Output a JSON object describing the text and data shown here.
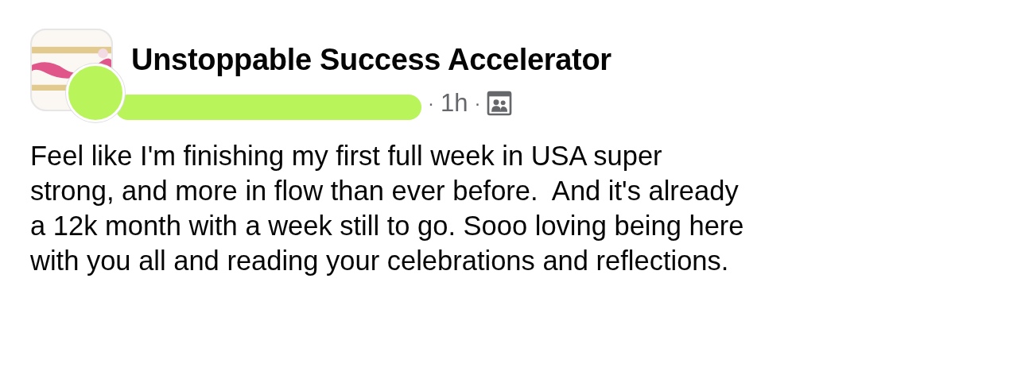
{
  "post": {
    "group_name": "Unstoppable Success Accelerator",
    "meta": {
      "separator_1": "·",
      "time": "1h",
      "separator_2": "·"
    },
    "body_lines": [
      "Feel like I'm finishing my first full week in USA super",
      "strong, and more in flow than ever before.  And it's already",
      "a 12k month with a week still to go. Sooo loving being here",
      "with you all and reading your celebrations and reflections."
    ]
  }
}
